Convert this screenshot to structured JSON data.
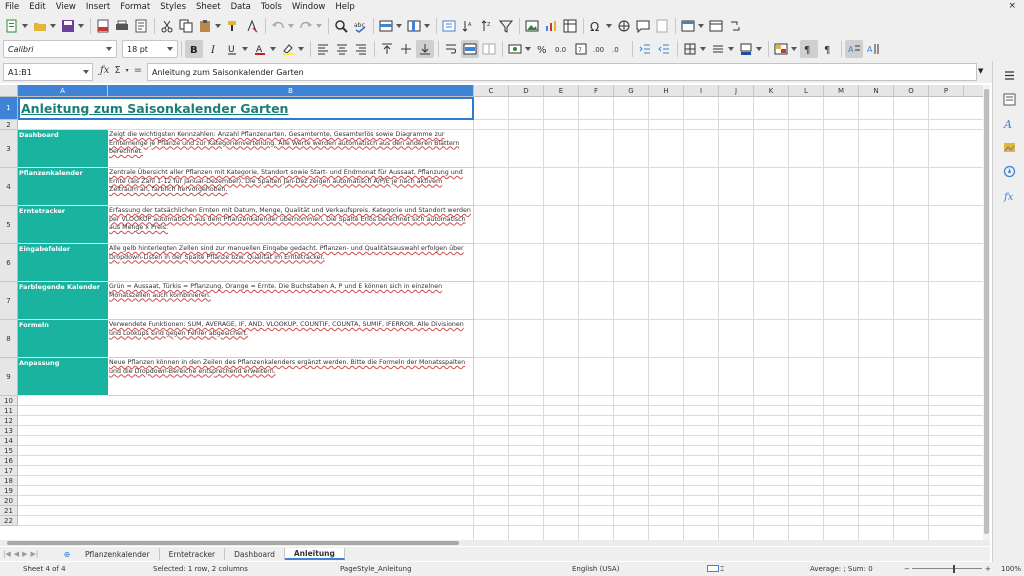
{
  "menu": [
    "File",
    "Edit",
    "View",
    "Insert",
    "Format",
    "Styles",
    "Sheet",
    "Data",
    "Tools",
    "Window",
    "Help"
  ],
  "menu_close": "×",
  "font": {
    "name": "Calibri",
    "size": "18 pt"
  },
  "formula": {
    "name_box": "A1:B1",
    "content": "Anleitung zum Saisonkalender Garten"
  },
  "columns": [
    "A",
    "B",
    "C",
    "D",
    "E",
    "F",
    "G",
    "H",
    "I",
    "J",
    "K",
    "L",
    "M",
    "N",
    "O",
    "P"
  ],
  "rows": [
    "1",
    "2",
    "3",
    "4",
    "5",
    "6",
    "7",
    "8",
    "9",
    "10",
    "11",
    "12",
    "13",
    "14",
    "15",
    "16",
    "17",
    "18",
    "19",
    "20",
    "21",
    "22"
  ],
  "title": "Anleitung zum Saisonkalender Garten",
  "entries": [
    {
      "label": "Dashboard",
      "text": "Zeigt die wichtigsten Kennzahlen: Anzahl Pflanzenarten, Gesamternte, Gesamterlös sowie Diagramme zur Erntemenge je Pflanze und zur Kategorienverteilung. Alle Werte werden automatisch aus den anderen Blättern berechnet."
    },
    {
      "label": "Pflanzenkalender",
      "text": "Zentrale Übersicht aller Pflanzen mit Kategorie, Standort sowie Start- und Endmonat für Aussaat, Pflanzung und Ernte (als Zahl 1-12 für Januar-Dezember). Die Spalten Jan-Dez zeigen automatisch A/P/E je nach aktivem Zeitraum an, farblich hervorgehoben."
    },
    {
      "label": "Erntetracker",
      "text": "Erfassung der tatsächlichen Ernten mit Datum, Menge, Qualität und Verkaufspreis. Kategorie und Standort werden per VLOOKUP automatisch aus dem Pflanzenkalender übernommen. Die Spalte Erlös berechnet sich automatisch aus Menge x Preis."
    },
    {
      "label": "Eingabefelder",
      "text": "Alle gelb hinterlegten Zellen sind zur manuellen Eingabe gedacht. Pflanzen- und Qualitätsauswahl erfolgen über Dropdown-Listen in der Spalte Pflanze bzw. Qualität im Erntetracker."
    },
    {
      "label": "Farblegende Kalender",
      "text": "Grün = Aussaat, Türkis = Pflanzung, Orange = Ernte. Die Buchstaben A, P und E können sich in einzelnen Monatszellen auch kombinieren."
    },
    {
      "label": "Formeln",
      "text": "Verwendete Funktionen: SUM, AVERAGE, IF, AND, VLOOKUP, COUNTIF, COUNTA, SUMIF, IFERROR. Alle Divisionen und Lookups sind gegen Fehler abgesichert."
    },
    {
      "label": "Anpassung",
      "text": "Neue Pflanzen können in den Zeilen des Pflanzenkalenders ergänzt werden. Bitte die Formeln der Monatsspalten und die Dropdown-Bereiche entsprechend erweitern."
    }
  ],
  "tabs": [
    "Pflanzenkalender",
    "Erntetracker",
    "Dashboard",
    "Anleitung"
  ],
  "status": {
    "sheet": "Sheet 4 of 4",
    "selection": "Selected: 1 row, 2 columns",
    "page_style": "PageStyle_Anleitung",
    "language": "English (USA)",
    "sum": "Average: ; Sum: 0",
    "zoom": "100%"
  },
  "colors": {
    "accent": "#19b3a0",
    "title": "#1a7f74",
    "selection": "#3e83d6"
  }
}
